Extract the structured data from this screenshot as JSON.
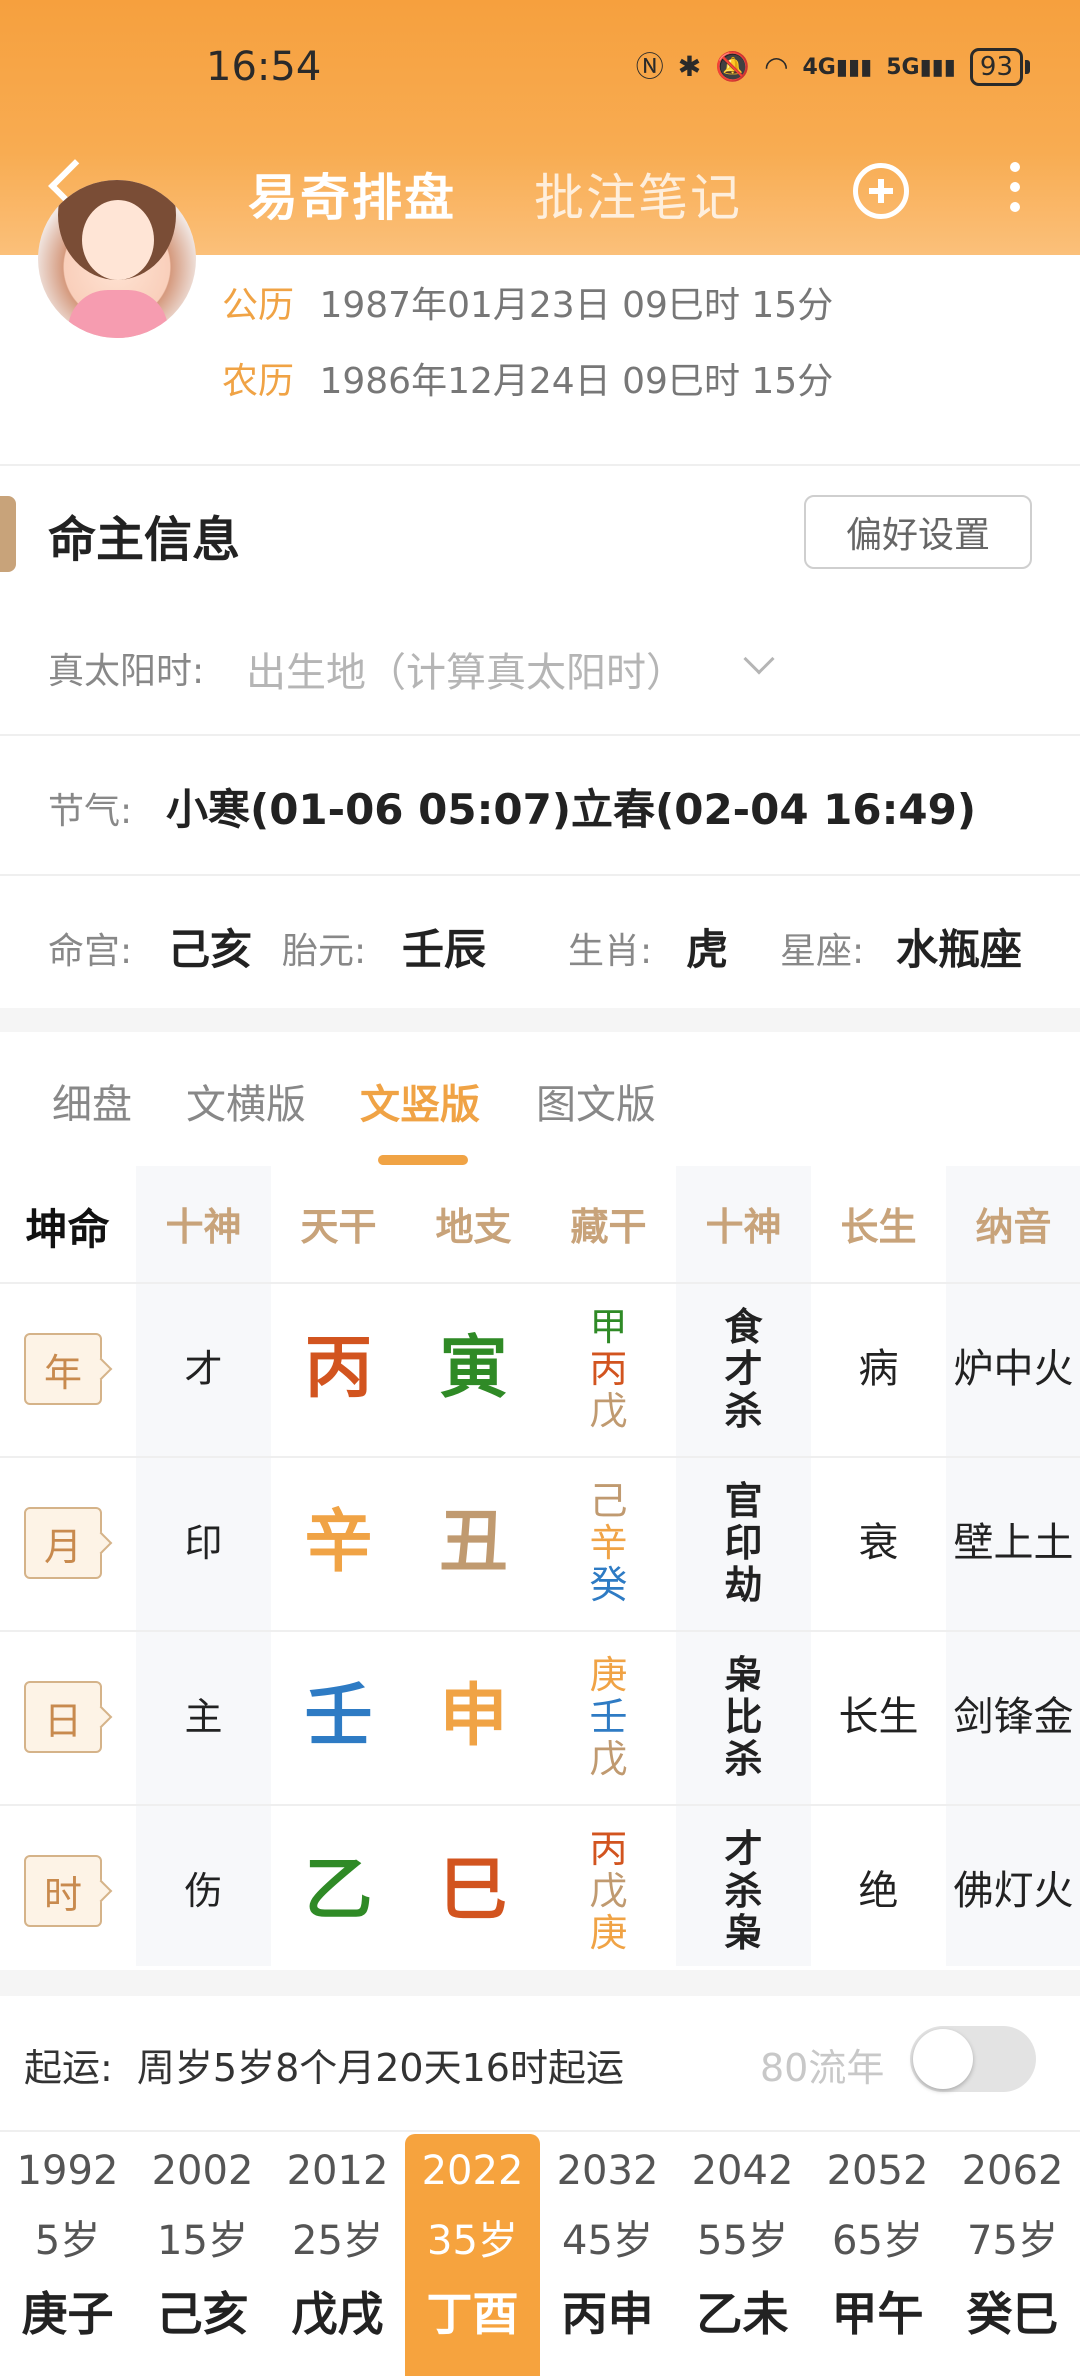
{
  "status_bar": {
    "time": "16:54",
    "icons": [
      "nfc-icon",
      "bluetooth-icon",
      "mute-icon",
      "wifi-icon",
      "4g-signal-icon",
      "5g-signal-icon"
    ],
    "net1": "4G",
    "net2": "5G",
    "battery": "93"
  },
  "header": {
    "tabs": [
      {
        "label": "易奇排盘",
        "active": true
      },
      {
        "label": "批注笔记",
        "active": false
      }
    ]
  },
  "profile": {
    "solar_label": "公历",
    "solar_value": "1987年01月23日 09巳时 15分",
    "lunar_label": "农历",
    "lunar_value": "1986年12月24日 09巳时 15分"
  },
  "info": {
    "title": "命主信息",
    "pref_button": "偏好设置",
    "true_solar_label": "真太阳时:",
    "true_solar_placeholder": "出生地（计算真太阳时）",
    "jieqi_label": "节气:",
    "jieqi_value": "小寒(01-06 05:07)立春(02-04 16:49)",
    "minggong_label": "命宫:",
    "minggong_value": "己亥",
    "taiyuan_label": "胎元:",
    "taiyuan_value": "壬辰",
    "shengxiao_label": "生肖:",
    "shengxiao_value": "虎",
    "xingzuo_label": "星座:",
    "xingzuo_value": "水瓶座"
  },
  "view_tabs": [
    {
      "label": "细盘",
      "active": false
    },
    {
      "label": "文横版",
      "active": false
    },
    {
      "label": "文竖版",
      "active": true
    },
    {
      "label": "图文版",
      "active": false
    }
  ],
  "grid": {
    "headers": [
      "坤命",
      "十神",
      "天干",
      "地支",
      "藏干",
      "十神",
      "长生",
      "纳音"
    ],
    "rows": [
      {
        "pillar": "年",
        "shishen": "才",
        "gan": "丙",
        "gan_color": "#d2541f",
        "zhi": "寅",
        "zhi_color": "#2f8a26",
        "canggan": [
          {
            "c": "甲",
            "color": "#2f8a26"
          },
          {
            "c": "丙",
            "color": "#d2541f"
          },
          {
            "c": "戊",
            "color": "#c09a70"
          }
        ],
        "shishen2": [
          "食",
          "才",
          "杀"
        ],
        "changsheng": "病",
        "nayin": "炉中火"
      },
      {
        "pillar": "月",
        "shishen": "印",
        "gan": "辛",
        "gan_color": "#f0a345",
        "zhi": "丑",
        "zhi_color": "#c09a70",
        "canggan": [
          {
            "c": "己",
            "color": "#c09a70"
          },
          {
            "c": "辛",
            "color": "#f0a345"
          },
          {
            "c": "癸",
            "color": "#2e7bc4"
          }
        ],
        "shishen2": [
          "官",
          "印",
          "劫"
        ],
        "changsheng": "衰",
        "nayin": "壁上土"
      },
      {
        "pillar": "日",
        "shishen": "主",
        "gan": "壬",
        "gan_color": "#2e7bc4",
        "zhi": "申",
        "zhi_color": "#f0a345",
        "canggan": [
          {
            "c": "庚",
            "color": "#f0a345"
          },
          {
            "c": "壬",
            "color": "#2e7bc4"
          },
          {
            "c": "戊",
            "color": "#c09a70"
          }
        ],
        "shishen2": [
          "枭",
          "比",
          "杀"
        ],
        "changsheng": "长生",
        "nayin": "剑锋金"
      },
      {
        "pillar": "时",
        "shishen": "伤",
        "gan": "乙",
        "gan_color": "#2f8a26",
        "zhi": "巳",
        "zhi_color": "#d2541f",
        "canggan": [
          {
            "c": "丙",
            "color": "#d2541f"
          },
          {
            "c": "戊",
            "color": "#c09a70"
          },
          {
            "c": "庚",
            "color": "#f0a345"
          }
        ],
        "shishen2": [
          "才",
          "杀",
          "枭"
        ],
        "changsheng": "绝",
        "nayin": "佛灯火"
      }
    ]
  },
  "qiyun": {
    "label": "起运:",
    "value": "周岁5岁8个月20天16时起运",
    "flow_label": "80流年",
    "toggle_on": false
  },
  "dayun": [
    {
      "year": "1992",
      "age": "5岁",
      "gz": "庚子",
      "active": false
    },
    {
      "year": "2002",
      "age": "15岁",
      "gz": "己亥",
      "active": false
    },
    {
      "year": "2012",
      "age": "25岁",
      "gz": "戊戌",
      "active": false
    },
    {
      "year": "2022",
      "age": "35岁",
      "gz": "丁酉",
      "active": true
    },
    {
      "year": "2032",
      "age": "45岁",
      "gz": "丙申",
      "active": false
    },
    {
      "year": "2042",
      "age": "55岁",
      "gz": "乙未",
      "active": false
    },
    {
      "year": "2052",
      "age": "65岁",
      "gz": "甲午",
      "active": false
    },
    {
      "year": "2062",
      "age": "75岁",
      "gz": "癸巳",
      "active": false
    }
  ],
  "colors": {
    "accent": "#f0a345",
    "header_orange": "#f6a03e",
    "gold_label": "#c8a37a"
  }
}
